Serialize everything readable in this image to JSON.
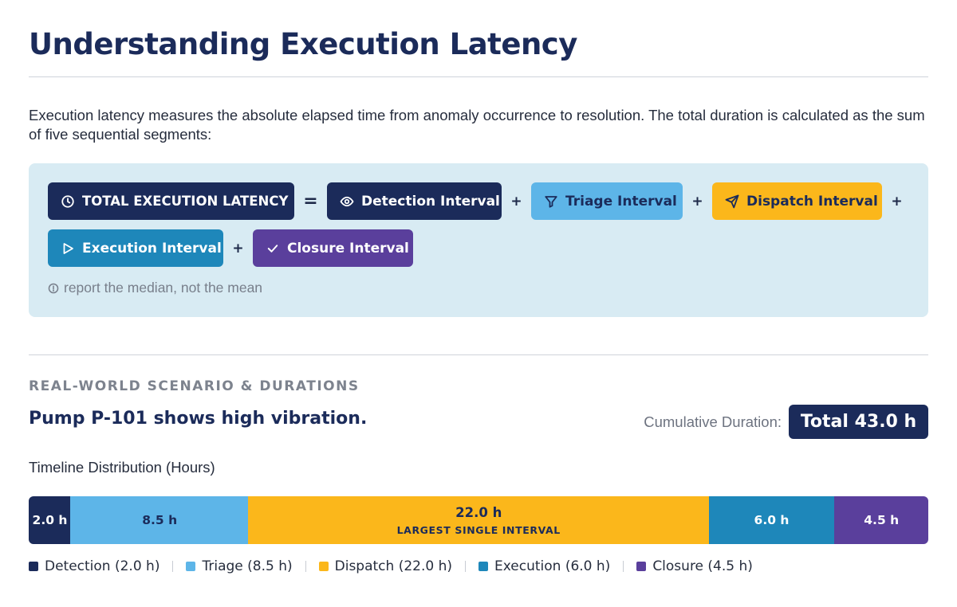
{
  "title": "Understanding Execution Latency",
  "intro": "Execution latency measures the absolute elapsed time from anomaly occurrence to resolution. The total duration is calculated as the sum of five sequential segments:",
  "formula": {
    "total_label": "TOTAL EXECUTION LATENCY",
    "equals": "=",
    "plus": "+",
    "terms": {
      "detection": "Detection Interval",
      "triage": "Triage Interval",
      "dispatch": "Dispatch Interval",
      "execution": "Execution Interval",
      "closure": "Closure Interval"
    },
    "note": "report the median, not the mean",
    "icons": {
      "total": "clock-icon",
      "detection": "eye-icon",
      "triage": "filter-icon",
      "dispatch": "send-icon",
      "execution": "play-icon",
      "closure": "check-icon",
      "note": "info-icon"
    }
  },
  "scenario": {
    "section_label": "REAL-WORLD SCENARIO & DURATIONS",
    "text": "Pump P-101 shows high vibration.",
    "cumulative_label": "Cumulative Duration:",
    "total_badge": "Total 43.0 h"
  },
  "chart_data": {
    "type": "bar",
    "orientation": "horizontal-stacked",
    "title": "Timeline Distribution (Hours)",
    "unit": "h",
    "categories": [
      "Detection",
      "Triage",
      "Dispatch",
      "Execution",
      "Closure"
    ],
    "values": [
      2.0,
      8.5,
      22.0,
      6.0,
      4.5
    ],
    "total": 43.0,
    "segment_labels": [
      "2.0 h",
      "8.5 h",
      "22.0 h",
      "6.0 h",
      "4.5 h"
    ],
    "annotation": {
      "segment": "Dispatch",
      "text": "LARGEST SINGLE INTERVAL"
    },
    "legend": [
      "Detection (2.0 h)",
      "Triage (8.5 h)",
      "Dispatch (22.0 h)",
      "Execution (6.0 h)",
      "Closure (4.5 h)"
    ],
    "legend_position": "bottom",
    "colors": [
      "#1b2b5a",
      "#5db5e8",
      "#fbb71b",
      "#1e87ba",
      "#5a3f9c"
    ],
    "text_colors": [
      "#ffffff",
      "#1b2b5a",
      "#1b2b5a",
      "#ffffff",
      "#ffffff"
    ]
  }
}
